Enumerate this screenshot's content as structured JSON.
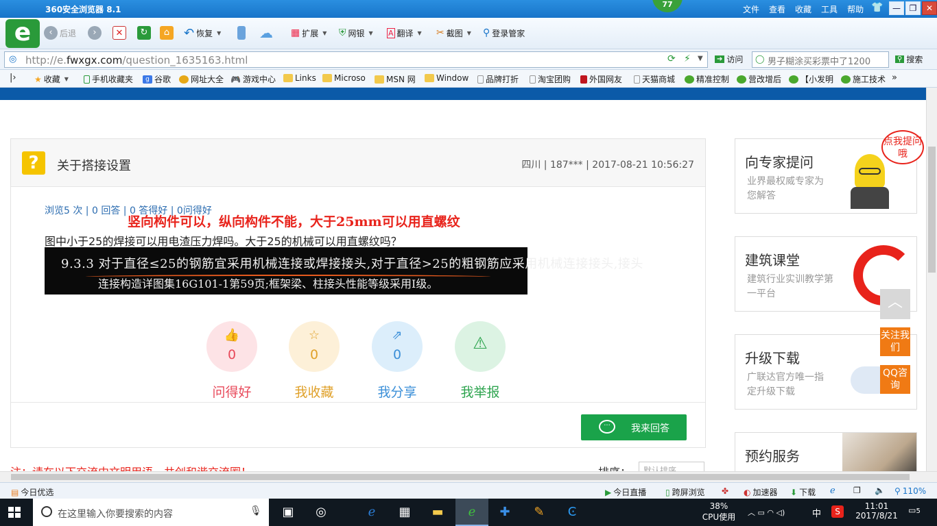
{
  "window": {
    "title": "360安全浏览器 8.1",
    "badge": "77",
    "menu": [
      "文件",
      "查看",
      "收藏",
      "工具",
      "帮助"
    ],
    "controls": {
      "min": "—",
      "restore": "❐",
      "close": "✕"
    }
  },
  "toolbar": {
    "back": "后退",
    "restore": "恢复",
    "extend": "扩展",
    "bank": "网银",
    "translate": "翻译",
    "screenshot": "截图",
    "login": "登录管家"
  },
  "address": {
    "url_prefix": "http://e.",
    "url_domain": "fwxgx.com",
    "url_path": "/question_1635163.html",
    "visit": "访问",
    "search_placeholder": "男子糊涂买彩票中了1200",
    "search": "搜索"
  },
  "bookmarks": [
    "收藏",
    "手机收藏夹",
    "谷歌",
    "网址大全",
    "游戏中心",
    "Links",
    "Microso",
    "MSN 网",
    "Window",
    "品牌打折",
    "淘宝团购",
    "外国网友",
    "天猫商城",
    "精准控制",
    "营改增后",
    "【小发明",
    "施工技术"
  ],
  "question": {
    "title": "关于搭接设置",
    "meta": "四川 | 187*** | 2017-08-21 10:56:27",
    "stats": "浏览5 次 | 0 回答 | 0 答得好 | 0问得好",
    "annotation": "竖向构件可以，纵向构件不能，大于25mm可以用直螺纹",
    "body": "图中小于25的焊接可以用电渣压力焊吗。大于25的机械可以用直螺纹吗？",
    "image_line1": "9.3.3  对于直径≤25的钢筋宜采用机械连接或焊接接头,对于直径>25的粗钢筋应采用机械连接接头,接头",
    "image_line2": "连接构造详图集16G101-1第59页;框架梁、柱接头性能等级采用I级。"
  },
  "actions": [
    {
      "label": "问得好",
      "count": "0",
      "icon": "thumbs-up-icon",
      "color": "#e8495a",
      "bg": "#fde3e6"
    },
    {
      "label": "我收藏",
      "count": "0",
      "icon": "star-icon",
      "color": "#e0a12a",
      "bg": "#fdf0d8"
    },
    {
      "label": "我分享",
      "count": "0",
      "icon": "share-icon",
      "color": "#3b8fd8",
      "bg": "#dceefb"
    },
    {
      "label": "我举报",
      "count": "0",
      "icon": "warning-icon",
      "color": "#2ea44f",
      "bg": "#dcf3e3"
    }
  ],
  "answer_button": "我来回答",
  "notice": "注：请在以下交流中文明用语，共创和谐交流圈！",
  "sort": {
    "label": "排序：",
    "value": "默认排序"
  },
  "sidebar": [
    {
      "title": "向专家提问",
      "subtitle": "业界最权威专家为您解答",
      "bubble": "点我提问哦"
    },
    {
      "title": "建筑课堂",
      "subtitle": "建筑行业实训教学第一平台"
    },
    {
      "title": "升级下载",
      "subtitle": "广联达官方唯一指定升级下载"
    },
    {
      "title": "预约服务"
    }
  ],
  "float_buttons": [
    "关注我们",
    "QQ咨询"
  ],
  "statusbar": {
    "left": "今日优选",
    "items": [
      "今日直播",
      "跨屏浏览",
      "加速器",
      "下载"
    ],
    "zoom": "110%"
  },
  "taskbar": {
    "search_placeholder": "在这里输入你要搜索的内容",
    "cpu_percent": "38%",
    "cpu_label": "CPU使用",
    "ime": "中",
    "time": "11:01",
    "date": "2017/8/21",
    "notifications": "5"
  },
  "colors": {
    "accent_blue": "#1874c9",
    "brand_green": "#2a9a3a",
    "answer_green": "#1aa34a",
    "alert_red": "#e8231b",
    "float_orange": "#f07a14"
  }
}
